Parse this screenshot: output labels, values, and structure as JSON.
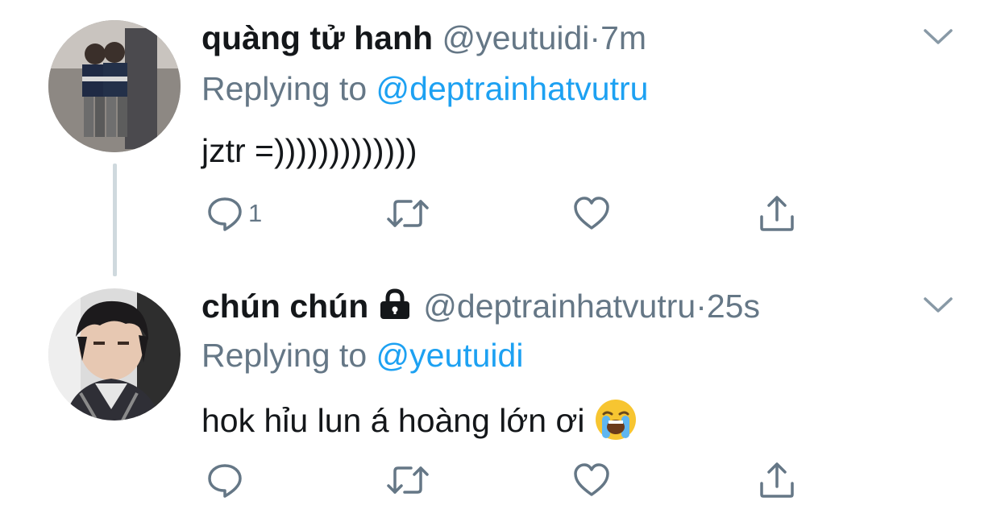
{
  "tweets": [
    {
      "name": "quàng tử hanh",
      "handle": "@yeutuidi",
      "separator": "·",
      "time": "7m",
      "replying_prefix": "Replying to ",
      "replying_to": "@deptrainhatvutru",
      "text": "jztr =)))))))))))))",
      "reply_count": "1",
      "locked": false
    },
    {
      "name": "chún chún",
      "handle": "@deptrainhatvutru",
      "separator": "·",
      "time": "25s",
      "replying_prefix": "Replying to ",
      "replying_to": "@yeutuidi",
      "text": "hok hỉu lun á hoàng lớn ơi",
      "reply_count": "",
      "locked": true,
      "emoji": "loudly-crying-face"
    }
  ],
  "icons": {
    "reply": "reply-icon",
    "retweet": "retweet-icon",
    "like": "heart-icon",
    "share": "share-icon",
    "more": "chevron-down-icon",
    "lock": "lock-icon"
  },
  "colors": {
    "name": "#14171a",
    "secondary": "#657786",
    "mention": "#1da1f2",
    "thread_line": "#cfd9de"
  }
}
